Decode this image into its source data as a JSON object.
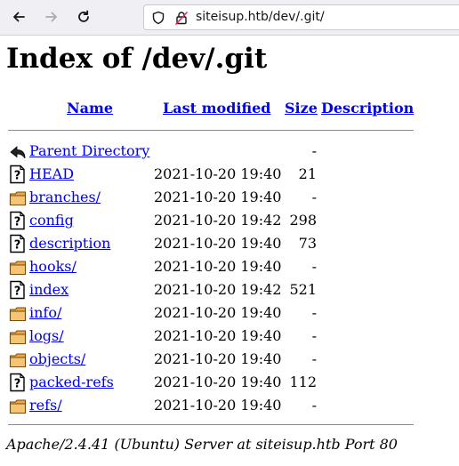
{
  "browser": {
    "url": "siteisup.htb/dev/.git/"
  },
  "page": {
    "title": "Index of /dev/.git",
    "columns": {
      "name": "Name",
      "last_modified": "Last modified",
      "size": "Size",
      "description": "Description"
    },
    "rows": [
      {
        "name": "Parent Directory",
        "date": "",
        "size": "-",
        "icon": "back-icon"
      },
      {
        "name": "HEAD",
        "date": "2021-10-20 19:40",
        "size": "21",
        "icon": "file-unknown-icon"
      },
      {
        "name": "branches/",
        "date": "2021-10-20 19:40",
        "size": "-",
        "icon": "folder-icon"
      },
      {
        "name": "config",
        "date": "2021-10-20 19:42",
        "size": "298",
        "icon": "file-unknown-icon"
      },
      {
        "name": "description",
        "date": "2021-10-20 19:40",
        "size": "73",
        "icon": "file-unknown-icon"
      },
      {
        "name": "hooks/",
        "date": "2021-10-20 19:40",
        "size": "-",
        "icon": "folder-icon"
      },
      {
        "name": "index",
        "date": "2021-10-20 19:42",
        "size": "521",
        "icon": "file-unknown-icon"
      },
      {
        "name": "info/",
        "date": "2021-10-20 19:40",
        "size": "-",
        "icon": "folder-icon"
      },
      {
        "name": "logs/",
        "date": "2021-10-20 19:40",
        "size": "-",
        "icon": "folder-icon"
      },
      {
        "name": "objects/",
        "date": "2021-10-20 19:40",
        "size": "-",
        "icon": "folder-icon"
      },
      {
        "name": "packed-refs",
        "date": "2021-10-20 19:40",
        "size": "112",
        "icon": "file-unknown-icon"
      },
      {
        "name": "refs/",
        "date": "2021-10-20 19:40",
        "size": "-",
        "icon": "folder-icon"
      }
    ],
    "footer": "Apache/2.4.41 (Ubuntu) Server at siteisup.htb Port 80"
  }
}
